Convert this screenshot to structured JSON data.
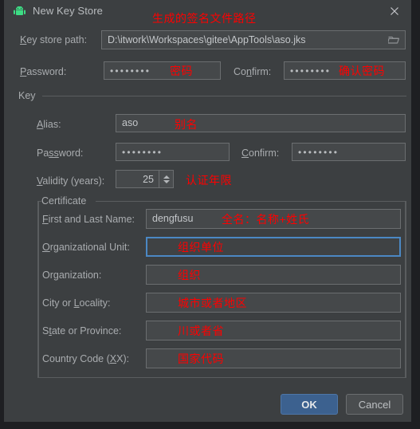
{
  "window": {
    "title": "New Key Store",
    "app_icon": "android-robot-icon",
    "close_icon": "close-icon"
  },
  "colors": {
    "background": "#3c3f41",
    "field_background": "#45484a",
    "field_border": "#6b6e70",
    "focus_border": "#4b88c4",
    "annotation_red": "#fe0000",
    "primary_button": "#3c618f",
    "android_green": "#3ddc84",
    "text": "#a9acaf"
  },
  "keystore": {
    "path_label": "Key store path:",
    "path_label_mnemonic": "K",
    "path_value": "D:\\itwork\\Workspaces\\gitee\\AppTools\\aso.jks",
    "path_annotation": "生成的签名文件路径",
    "browse_icon": "folder-open-icon",
    "password_label": "Password:",
    "password_label_mnemonic": "P",
    "password_value": "••••••••",
    "password_annotation": "密码",
    "confirm_label": "Confirm:",
    "confirm_label_mnemonic": "n",
    "confirm_value": "••••••••",
    "confirm_annotation": "确认密码"
  },
  "key": {
    "group_title": "Key",
    "alias_label": "Alias:",
    "alias_label_mnemonic": "A",
    "alias_value": "aso",
    "alias_annotation": "别名",
    "password_label": "Password:",
    "password_label_mnemonic": "ss",
    "password_value": "••••••••",
    "confirm_label": "Confirm:",
    "confirm_label_mnemonic": "C",
    "confirm_value": "••••••••",
    "validity_label": "Validity (years):",
    "validity_label_mnemonic": "V",
    "validity_value": "25",
    "validity_annotation": "认证年限",
    "spinner_up_icon": "chevron-up-icon",
    "spinner_down_icon": "chevron-down-icon"
  },
  "certificate": {
    "group_title": "Certificate",
    "rows": [
      {
        "label": "First and Last Name:",
        "value": "dengfusu",
        "annotation": "全名：名称+姓氏",
        "focused": false
      },
      {
        "label": "Organizational Unit:",
        "value": "",
        "annotation": "组织单位",
        "focused": true
      },
      {
        "label": "Organization:",
        "value": "",
        "annotation": "组织",
        "focused": false
      },
      {
        "label": "City or Locality:",
        "value": "",
        "annotation": "城市或者地区",
        "focused": false
      },
      {
        "label": "State or Province:",
        "value": "",
        "annotation": "川或者省",
        "focused": false
      },
      {
        "label": "Country Code (XX):",
        "value": "",
        "annotation": "国家代码",
        "focused": false
      }
    ]
  },
  "footer": {
    "ok_label": "OK",
    "cancel_label": "Cancel"
  }
}
